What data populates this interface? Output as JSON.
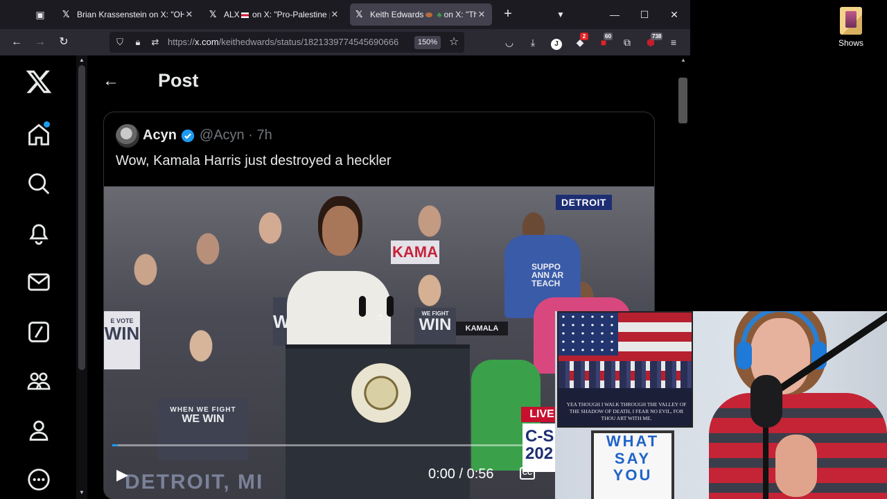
{
  "browser": {
    "tabs": [
      {
        "title": "Brian Krassenstein on X: \"OH M",
        "active": false
      },
      {
        "title_pre": "ALX",
        "title_post": "on X: \"Pro-Palestine pro",
        "active": false
      },
      {
        "title_pre": "Keith Edwards",
        "title_post": "on X: \"This",
        "active": true
      }
    ],
    "url": {
      "scheme": "https://",
      "host": "x.com",
      "path": "/keithedwards/status/1821339774545690666"
    },
    "zoom": "150%",
    "extensions": [
      {
        "icon": "pocket-icon"
      },
      {
        "icon": "download-icon"
      },
      {
        "icon": "j-extension-icon"
      },
      {
        "icon": "extension-a-icon",
        "badge": "2"
      },
      {
        "icon": "extension-b-icon",
        "badge": "60"
      },
      {
        "icon": "puzzle-icon"
      },
      {
        "icon": "ublock-icon",
        "badge": "738"
      }
    ]
  },
  "x": {
    "header": {
      "title": "Post"
    },
    "tweet": {
      "author": "Acyn",
      "handle_time": "@Acyn · 7h",
      "text": "Wow, Kamala Harris just destroyed a heckler"
    },
    "video": {
      "location_badge": "DETROIT",
      "live_badge": "LIVE",
      "network_text": "C-S\n202",
      "lower_third": "DETROIT, MI",
      "sign_big_1": "WE WIN",
      "sign_small_1": "WHEN WE FIGHT",
      "sign_2": "WIN",
      "sign_3_small": "WE FIGHT",
      "sign_3_big": "WIN",
      "sign_4": "KAMALA",
      "shirt_text": "SUPPO\nANN AR\nTEACH",
      "sign_5": "KAMA",
      "sign_6_small": "E VOTE",
      "sign_6_big": "WIN",
      "time": "0:00 / 0:56",
      "progress": 0.01,
      "cc_label": "CC"
    }
  },
  "desktop": {
    "folder_label": "Shows"
  },
  "webcam": {
    "poster_caption": "YEA THOUGH I WALK THROUGH THE VALLEY OF THE SHADOW OF DEATH, I FEAR NO EVIL, FOR THOU ART WITH ME.",
    "lightbox": [
      "WHAT",
      "SAY",
      "YOU"
    ]
  }
}
